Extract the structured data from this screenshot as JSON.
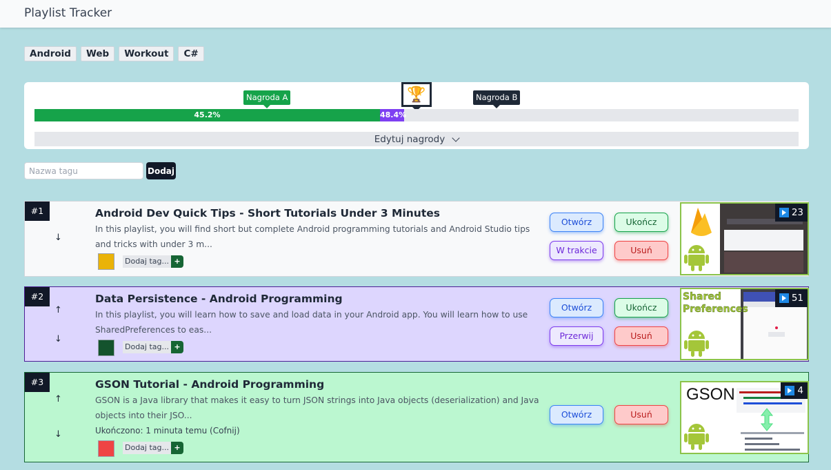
{
  "app": {
    "title": "Playlist Tracker"
  },
  "tag_filters": [
    "Android",
    "Web",
    "Workout",
    "C#"
  ],
  "progress": {
    "green_label": "45.2%",
    "green_value": 45.2,
    "purple_label": "48.4%",
    "purple_value": 48.4,
    "reward_a": "Nagroda A",
    "reward_b": "Nagroda B",
    "trophy_icon": "trophy-icon",
    "edit_label": "Edytuj nagrody"
  },
  "new_tag": {
    "placeholder": "Nazwa tagu",
    "button": "Dodaj"
  },
  "colors": {
    "accent_green": "#16a34a",
    "accent_purple": "#7e3ff2",
    "dark": "#111827"
  },
  "playlists": [
    {
      "rank": "#1",
      "title": "Android Dev Quick Tips - Short Tutorials Under 3 Minutes",
      "description": "In this playlist, you will find short but complete Android programming tutorials and Android Studio tips and tricks with under 3 m...",
      "tag_add": "Dodaj tag...",
      "swatch": "#eab308",
      "bg": "#f8f9fa",
      "buttons": {
        "open": "Otwórz",
        "finish": "Ukończ",
        "progress": "W trakcie",
        "delete": "Usuń"
      },
      "count": "23",
      "arrows": [
        "↓"
      ]
    },
    {
      "rank": "#2",
      "title": "Data Persistence - Android Programming",
      "description": "In this playlist, you will learn how to save and load data in your Android app. You will learn how to use SharedPreferences to eas...",
      "tag_add": "Dodaj tag...",
      "swatch": "#14532d",
      "bg": "#ddd6fe",
      "buttons": {
        "open": "Otwórz",
        "finish": "Ukończ",
        "progress": "Przerwij",
        "delete": "Usuń"
      },
      "count": "51",
      "thumb_text": "Shared Preferences",
      "arrows": [
        "↑",
        "↓"
      ]
    },
    {
      "rank": "#3",
      "title": "GSON Tutorial - Android Programming",
      "description": "GSON is a Java library that makes it easy to turn JSON strings into Java objects (deserialization) and Java objects into their JSO...",
      "completed": "Ukończono: 1 minuta temu (Cofnij)",
      "tag_add": "Dodaj tag...",
      "swatch": "#ef4444",
      "bg": "#bbf7d0",
      "buttons": {
        "open": "Otwórz",
        "delete": "Usuń"
      },
      "count": "4",
      "thumb_text": "GSON",
      "arrows": [
        "↑",
        "↓"
      ]
    }
  ]
}
